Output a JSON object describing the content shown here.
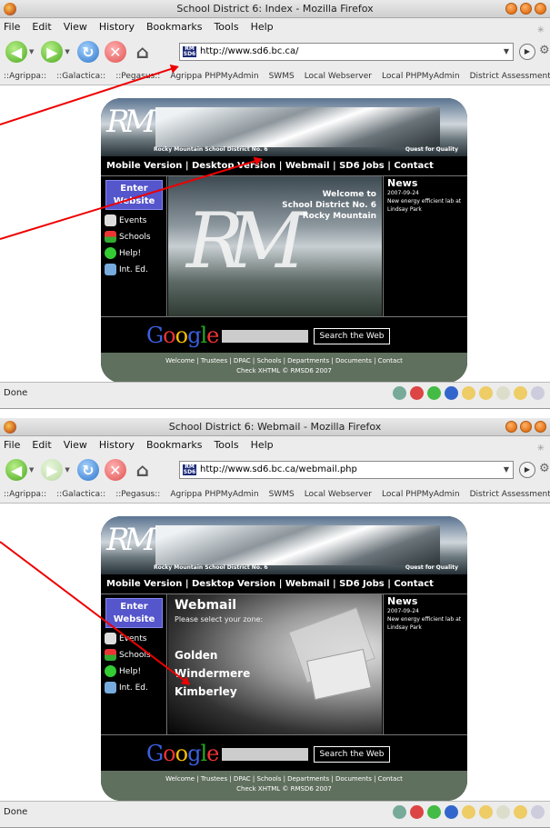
{
  "windows": [
    {
      "title": "School District 6: Index - Mozilla Firefox",
      "menu": [
        "File",
        "Edit",
        "View",
        "History",
        "Bookmarks",
        "Tools",
        "Help"
      ],
      "url": "http://www.sd6.bc.ca/",
      "status": "Done",
      "site": {
        "view": "home"
      }
    },
    {
      "title": "School District 6: Webmail - Mozilla Firefox",
      "menu": [
        "File",
        "Edit",
        "View",
        "History",
        "Bookmarks",
        "Tools",
        "Help"
      ],
      "url": "http://www.sd6.bc.ca/webmail.php",
      "status": "Done",
      "site": {
        "view": "webmail"
      }
    }
  ],
  "bookmarks": [
    "::Agrippa::",
    "::Galactica::",
    "::Pegasus::",
    "Agrippa PHPMyAdmin",
    "SWMS",
    "Local Webserver",
    "Local PHPMyAdmin",
    "District Assessment"
  ],
  "site": {
    "logo_text": "RM",
    "district_name": "Rocky Mountain School District No. 6",
    "motto": "Quest for Quality",
    "topnav": "Mobile Version | Desktop Version | Webmail | SD6 Jobs | Contact",
    "enter_label": "Enter Website",
    "left_links": [
      "Events",
      "Schools",
      "Help!",
      "Int. Ed."
    ],
    "welcome": [
      "Welcome to",
      "School District No. 6",
      "Rocky Mountain"
    ],
    "news_title": "News",
    "news_date": "2007-09-24",
    "news_text": "New energy efficient lab at Lindsay Park",
    "google_logo": "Google",
    "google_button": "Search the Web",
    "footer_links": "Welcome | Trustees | DPAC | Schools | Departments | Documents | Contact",
    "footer_check": "Check XHTML © RMSD6 2007",
    "webmail_title": "Webmail",
    "webmail_prompt": "Please select your zone:",
    "zones": [
      "Golden",
      "Windermere",
      "Kimberley"
    ]
  },
  "colors": {
    "enter_button": "#5555cc",
    "footer": "#60705e",
    "arrow": "#e00000"
  }
}
